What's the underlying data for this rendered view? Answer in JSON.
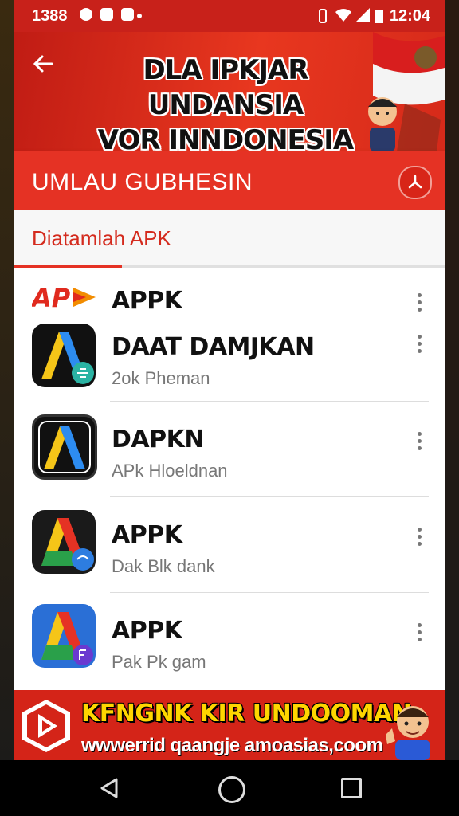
{
  "status_bar": {
    "left_time": "1388",
    "right_time": "12:04"
  },
  "header": {
    "back_icon": "arrow-back-icon",
    "banner_line1": "DLA IPKJAR UNDANSIA",
    "banner_line2": "VOR INNDONESIA"
  },
  "section": {
    "label": "UMLAU GUBHESIN",
    "action_icon": "share-icon"
  },
  "tab": {
    "label": "Diatamlah APK"
  },
  "list": {
    "items": [
      {
        "title": "APPK",
        "subtitle": "",
        "icon": "ap-logo-icon"
      },
      {
        "title": "DAAT DAMJKAN",
        "subtitle": "2ok Pheman",
        "icon": "app-a-icon"
      },
      {
        "title": "DAPKN",
        "subtitle": "APk Hloeldnan",
        "icon": "app-a-frame-icon"
      },
      {
        "title": "APPK",
        "subtitle": "Dak Blk dank",
        "icon": "app-a-color-icon"
      },
      {
        "title": "APPK",
        "subtitle": "Pak Pk gam",
        "icon": "app-a-blue-icon"
      }
    ]
  },
  "ad": {
    "title": "KFNGNK KIR UNDOOMAN",
    "url": "wwwerrid qaangje amoasias,coom"
  },
  "colors": {
    "primary": "#e53224",
    "dark_red": "#c8211a",
    "ad_yellow": "#ffd600"
  }
}
